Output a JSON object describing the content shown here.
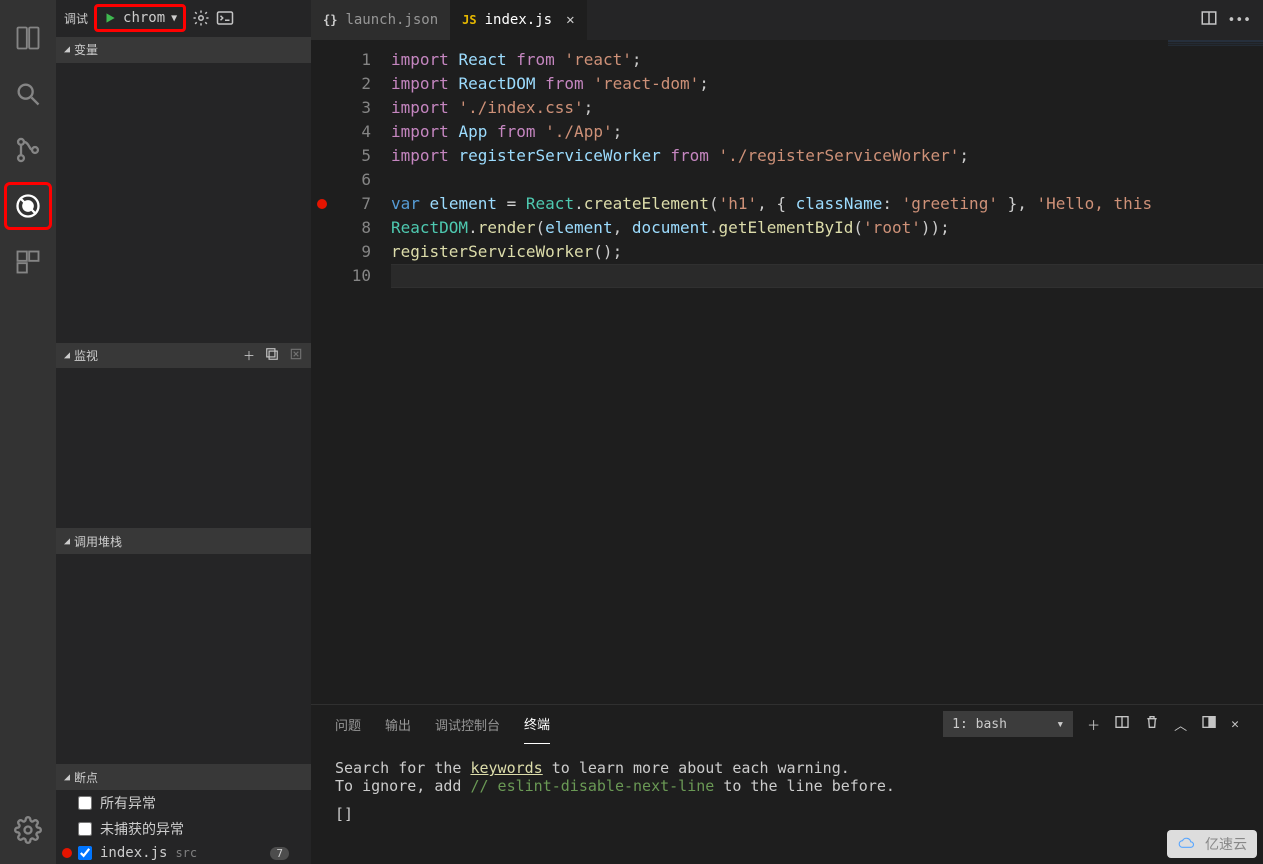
{
  "activity": {
    "active": "debug"
  },
  "debug": {
    "header_label": "调试",
    "config_name": "chrom",
    "sections": {
      "variables": "变量",
      "watch": "监视",
      "callstack": "调用堆栈",
      "breakpoints": "断点"
    },
    "breakpoints": {
      "all_exceptions": "所有异常",
      "uncaught": "未捕获的异常",
      "file": "index.js",
      "file_src": "src",
      "file_line": "7"
    }
  },
  "tabs": [
    {
      "icon": "{}",
      "label": "launch.json",
      "active": false
    },
    {
      "icon": "JS",
      "label": "index.js",
      "active": true
    }
  ],
  "code": {
    "lines": [
      {
        "n": 1,
        "html": "<span class='kw'>import</span> <span class='var'>React</span> <span class='kw'>from</span> <span class='str'>'react'</span>;"
      },
      {
        "n": 2,
        "html": "<span class='kw'>import</span> <span class='var'>ReactDOM</span> <span class='kw'>from</span> <span class='str'>'react-dom'</span>;"
      },
      {
        "n": 3,
        "html": "<span class='kw'>import</span> <span class='str'>'./index.css'</span>;"
      },
      {
        "n": 4,
        "html": "<span class='kw'>import</span> <span class='var'>App</span> <span class='kw'>from</span> <span class='str'>'./App'</span>;"
      },
      {
        "n": 5,
        "html": "<span class='kw'>import</span> <span class='var'>registerServiceWorker</span> <span class='kw'>from</span> <span class='str'>'./registerServiceWorker'</span>;"
      },
      {
        "n": 6,
        "html": ""
      },
      {
        "n": 7,
        "bp": true,
        "html": "<span class='vkw'>var</span> <span class='var'>element</span> <span class='op'>=</span> <span class='cls'>React</span>.<span class='fn'>createElement</span>(<span class='str'>'h1'</span>, { <span class='var'>className</span>: <span class='str'>'greeting'</span> }, <span class='str'>'Hello, this </span>"
      },
      {
        "n": 8,
        "html": "<span class='cls'>ReactDOM</span>.<span class='fn'>render</span>(<span class='var'>element</span>, <span class='var'>document</span>.<span class='fn'>getElementById</span>(<span class='str'>'root'</span>));"
      },
      {
        "n": 9,
        "html": "<span class='fn'>registerServiceWorker</span>();"
      },
      {
        "n": 10,
        "cursor": true,
        "html": ""
      }
    ]
  },
  "panel": {
    "tabs": {
      "problems": "问题",
      "output": "输出",
      "debug_console": "调试控制台",
      "terminal": "终端"
    },
    "terminal_select": "1: bash",
    "terminal": {
      "line1_a": "Search for the ",
      "line1_link": "keywords",
      "line1_b": " to learn more about each warning.",
      "line2_a": "To ignore, add ",
      "line2_comment": "// eslint-disable-next-line",
      "line2_b": " to the line before.",
      "cursor": "[]"
    }
  },
  "watermark": "亿速云"
}
